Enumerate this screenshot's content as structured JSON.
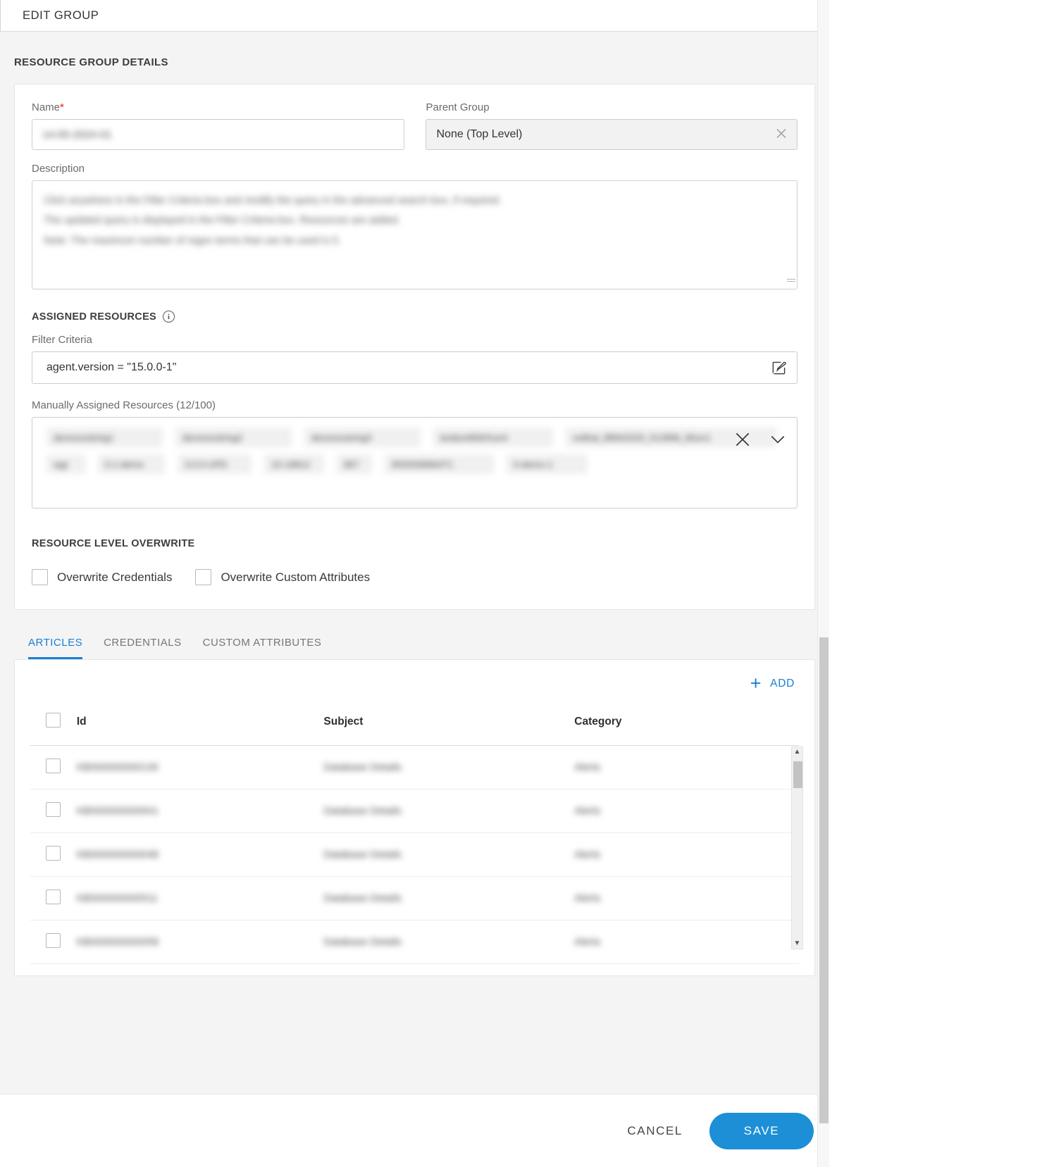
{
  "header": {
    "title": "EDIT GROUP"
  },
  "section": {
    "title": "RESOURCE GROUP DETAILS"
  },
  "form": {
    "name_label": "Name",
    "name_required_mark": "*",
    "name_value": "14-05-2024-01",
    "parent_label": "Parent Group",
    "parent_value": "None (Top Level)",
    "parent_clear_icon": "close-icon",
    "description_label": "Description",
    "description_value": "Click anywhere in the Filter Criteria box and modify the query in the advanced search box, if required.\nThe updated query is displayed in the Filter Criteria box. Resources are added.\nNote: The maximum number of regex terms that can be used is 5."
  },
  "assigned": {
    "heading": "ASSIGNED RESOURCES",
    "info_icon": "info-icon",
    "filter_label": "Filter Criteria",
    "filter_value": "agent.version = \"15.0.0-1\"",
    "filter_edit_icon": "edit-pencil-icon",
    "manual_label": "Manually Assigned Resources (12/100)",
    "manual_count": 12,
    "manual_max": 100,
    "clear_icon": "close-icon",
    "expand_icon": "chevron-down-icon",
    "chips": [
      "devmonstring1",
      "devmonstring2",
      "devmonstring3",
      "testlun96WXun4",
      "redhat_88942020_512896_80un1",
      "wgt",
      "0.1-demo",
      "3.0.0-UPD",
      "10-19812",
      "867",
      "8555568964T1",
      "0-demo-1"
    ]
  },
  "overwrite": {
    "heading": "RESOURCE LEVEL OVERWRITE",
    "options": [
      {
        "label": "Overwrite Credentials",
        "checked": false
      },
      {
        "label": "Overwrite Custom Attributes",
        "checked": false
      }
    ]
  },
  "tabs": [
    {
      "label": "ARTICLES",
      "active": true
    },
    {
      "label": "CREDENTIALS",
      "active": false
    },
    {
      "label": "CUSTOM ATTRIBUTES",
      "active": false
    }
  ],
  "articles": {
    "add_label": "ADD",
    "add_icon": "plus-icon",
    "columns": [
      "Id",
      "Subject",
      "Category"
    ],
    "rows": [
      {
        "id": "KB000000000130",
        "subject": "Database Details",
        "category": "Alerts"
      },
      {
        "id": "KB000000000941",
        "subject": "Database Details",
        "category": "Alerts"
      },
      {
        "id": "KB000000000048",
        "subject": "Database Details",
        "category": "Alerts"
      },
      {
        "id": "KB000000000511",
        "subject": "Database Details",
        "category": "Alerts"
      },
      {
        "id": "KB000000000058",
        "subject": "Database Details",
        "category": "Alerts"
      }
    ],
    "scroll_up_icon": "caret-up-icon",
    "scroll_down_icon": "caret-down-icon"
  },
  "footer": {
    "cancel_label": "CANCEL",
    "save_label": "SAVE"
  },
  "colors": {
    "accent": "#1a7fd4",
    "save_button": "#1c8fd6",
    "required": "#e02020"
  }
}
